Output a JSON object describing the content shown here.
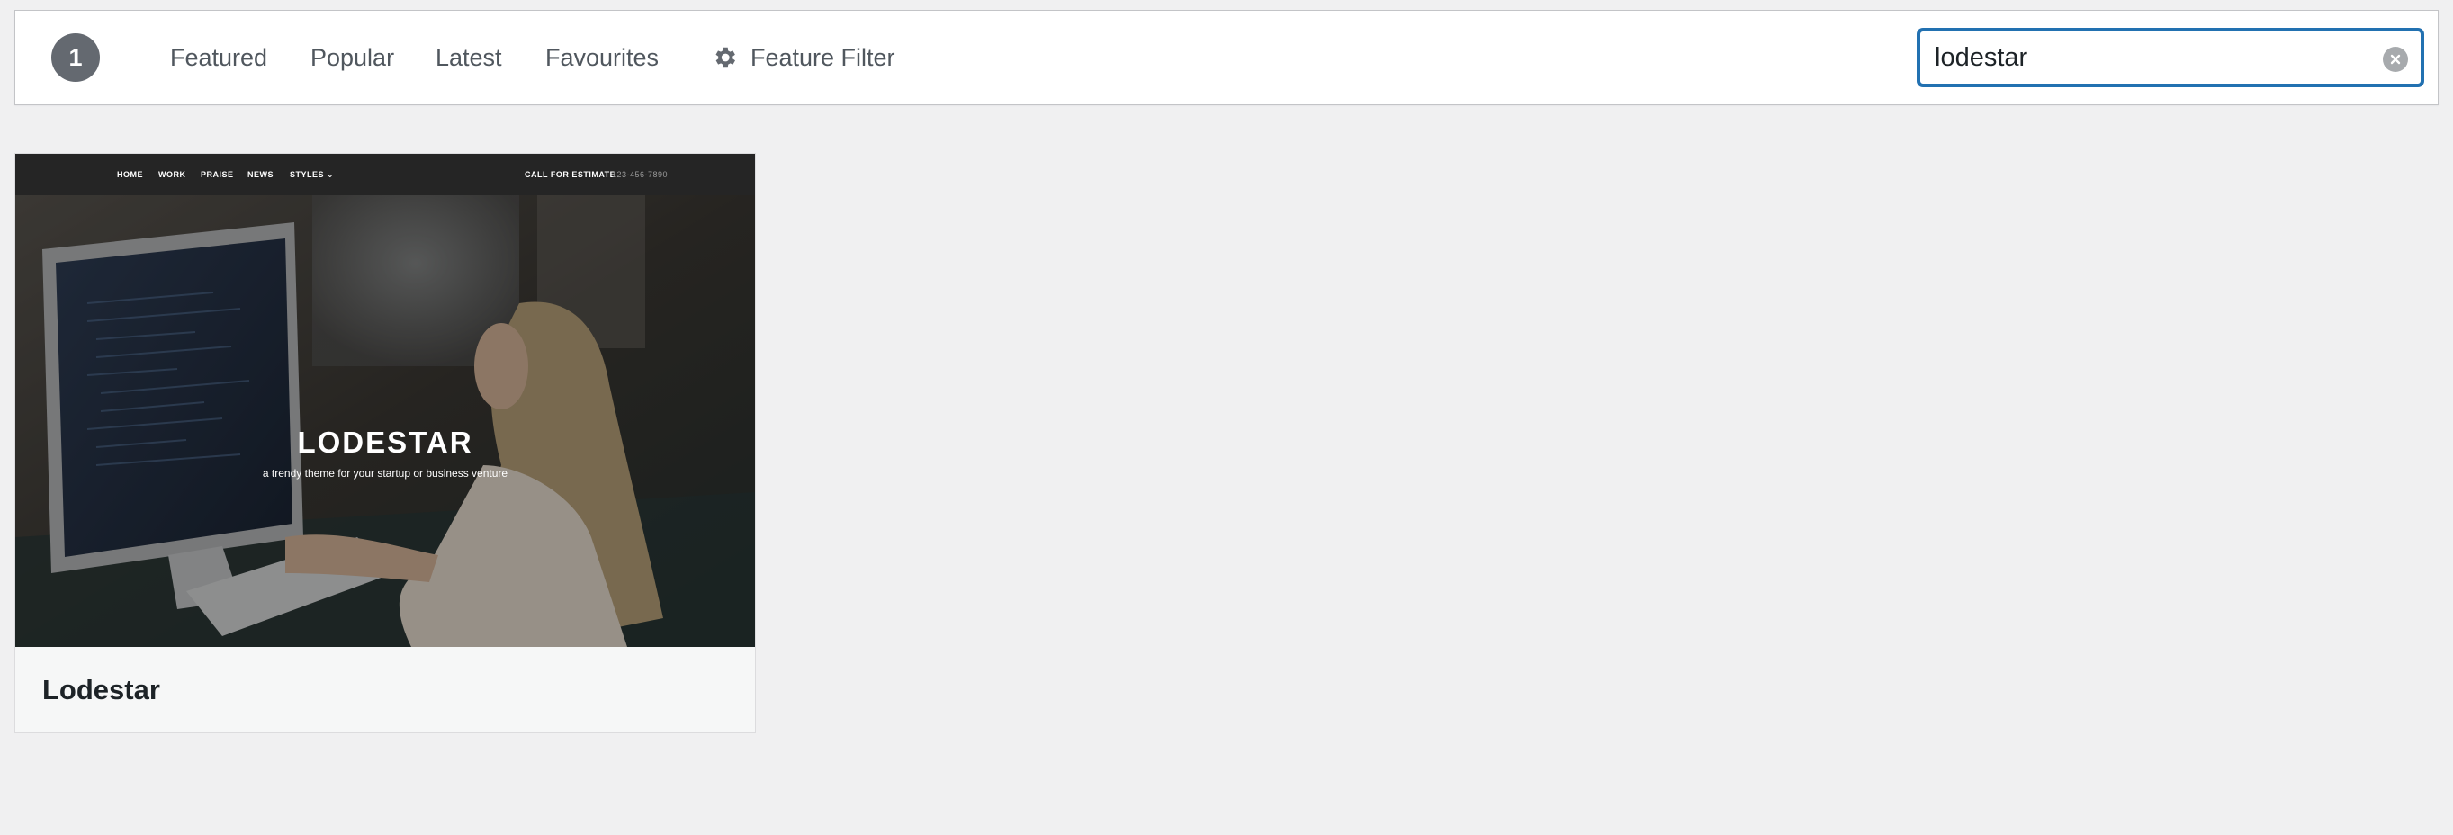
{
  "filter_bar": {
    "count": "1",
    "links": [
      "Featured",
      "Popular",
      "Latest",
      "Favourites"
    ],
    "feature_filter": "Feature Filter",
    "feature_filter_icon": "gear-icon"
  },
  "search": {
    "value": "lodestar",
    "clear_icon": "clear-icon"
  },
  "theme": {
    "name": "Lodestar",
    "preview": {
      "nav": [
        "HOME",
        "WORK",
        "PRAISE",
        "NEWS",
        "STYLES ⌄"
      ],
      "cta": "CALL FOR ESTIMATE",
      "phone": "123-456-7890",
      "headline": "LODESTAR",
      "tagline": "a trendy theme for your startup or business venture"
    }
  }
}
